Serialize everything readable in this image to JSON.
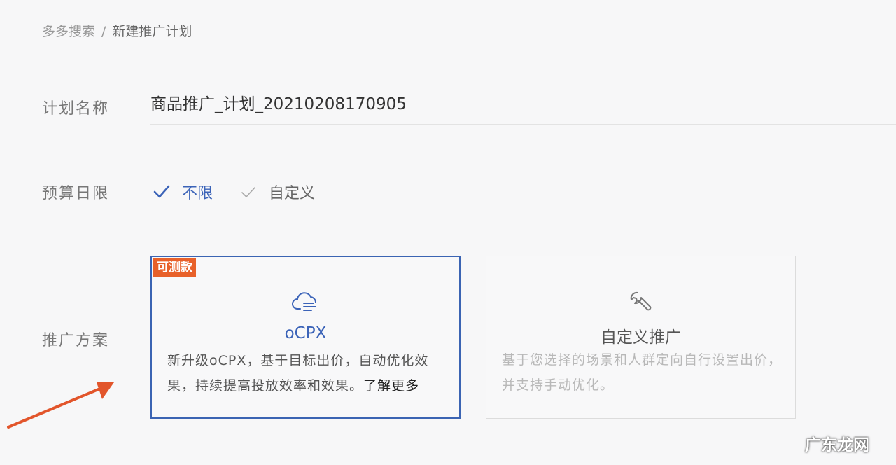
{
  "breadcrumb": {
    "root": "多多搜索",
    "separator": "/",
    "current": "新建推广计划"
  },
  "plan_name": {
    "label": "计划名称",
    "value": "商品推广_计划_20210208170905"
  },
  "budget": {
    "label": "预算日限",
    "options": [
      {
        "label": "不限",
        "selected": true
      },
      {
        "label": "自定义",
        "selected": false
      }
    ]
  },
  "scheme": {
    "label": "推广方案",
    "cards": [
      {
        "tag": "可测款",
        "icon": "cloud-ocpx-icon",
        "title": "oCPX",
        "description": "新升级oCPX，基于目标出价，自动优化效果，持续提高投放效率和效果。",
        "link": "了解更多",
        "selected": true
      },
      {
        "icon": "wrench-icon",
        "title": "自定义推广",
        "description": "基于您选择的场景和人群定向自行设置出价，并支持手动优化。",
        "selected": false
      }
    ]
  },
  "watermark": "广东龙网",
  "colors": {
    "accent": "#3b63b8",
    "tag": "#e8612a",
    "annotation_arrow": "#e2552b"
  }
}
